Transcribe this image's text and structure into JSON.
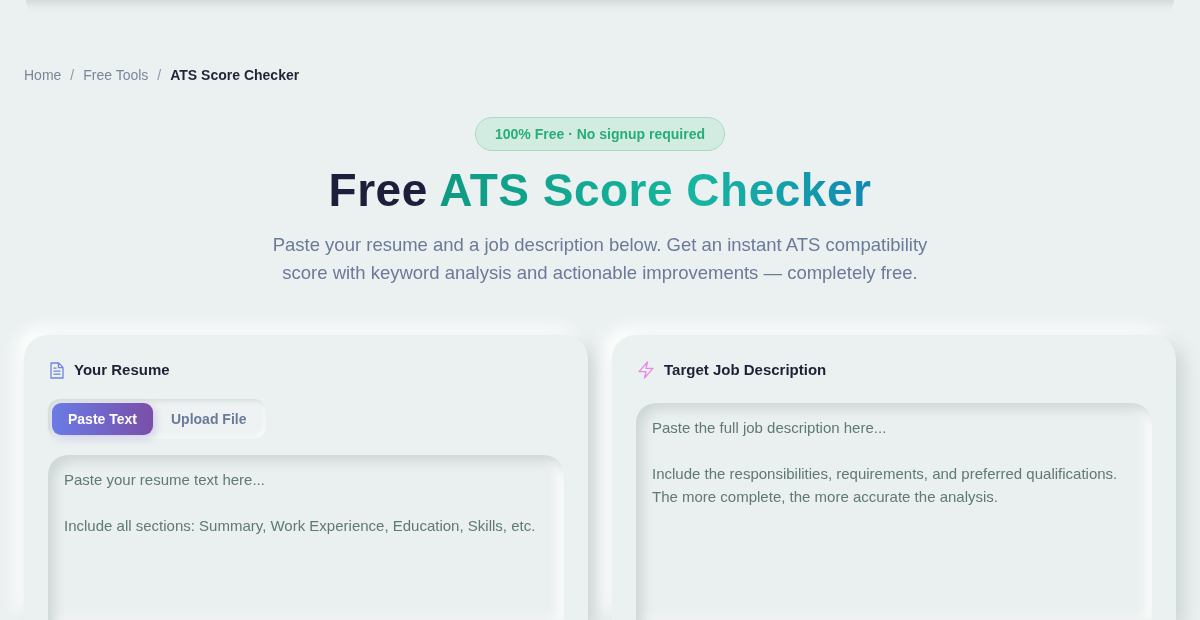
{
  "breadcrumb": {
    "items": [
      {
        "label": "Home",
        "current": false
      },
      {
        "label": "Free Tools",
        "current": false
      },
      {
        "label": "ATS Score Checker",
        "current": true
      }
    ],
    "separators": [
      "/",
      "/"
    ]
  },
  "badge": "100% Free · No signup required",
  "title": {
    "lead": "Free",
    "highlight": "ATS Score Checker"
  },
  "subtitle": "Paste your resume and a job description below. Get an instant ATS compatibility score with keyword analysis and actionable improvements — completely free.",
  "resume_panel": {
    "title": "Your Resume",
    "tabs": [
      {
        "label": "Paste Text",
        "selected": true
      },
      {
        "label": "Upload File",
        "selected": false
      }
    ],
    "textarea": {
      "placeholder": "Paste your resume text here...\n\nInclude all sections: Summary, Work Experience, Education, Skills, etc."
    }
  },
  "job_panel": {
    "title": "Target Job Description",
    "textarea": {
      "placeholder": "Paste the full job description here...\n\nInclude the responsibilities, requirements, and preferred qualifications.\nThe more complete, the more accurate the analysis."
    }
  }
}
